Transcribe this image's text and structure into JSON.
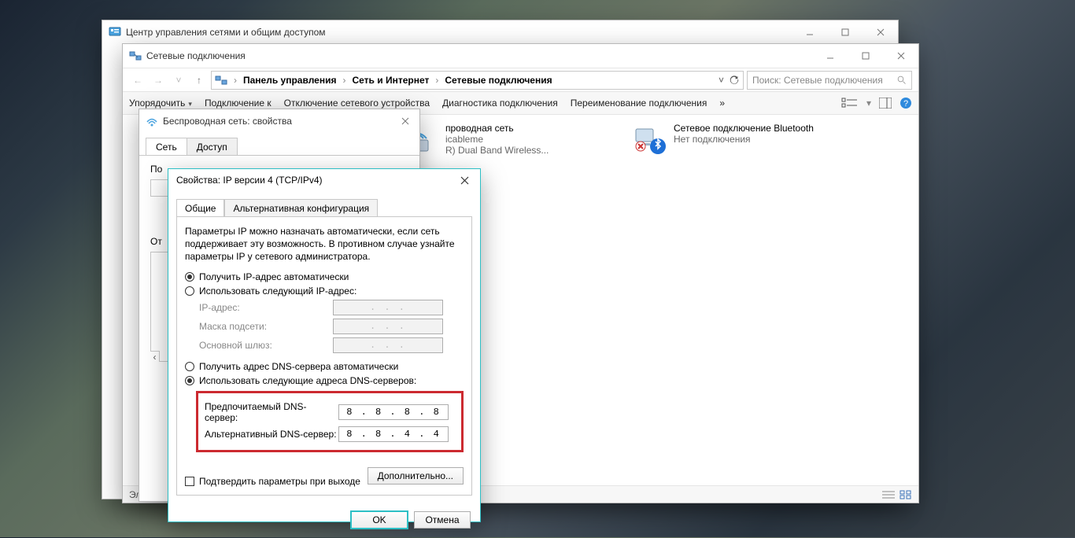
{
  "bgWin": {
    "title": "Центр управления сетями и общим доступом"
  },
  "explorer": {
    "title": "Сетевые подключения",
    "breadcrumb": [
      "Панель управления",
      "Сеть и Интернет",
      "Сетевые подключения"
    ],
    "search_placeholder": "Поиск: Сетевые подключения",
    "toolbar": {
      "organize": "Упорядочить",
      "connect": "Подключение к",
      "disable": "Отключение сетевого устройства",
      "diagnose": "Диагностика подключения",
      "rename": "Переименование подключения",
      "more": "»"
    },
    "connections": [
      {
        "name": "Беспроводная сеть",
        "line2": "icableme",
        "line3": "R) Dual Band Wireless..."
      },
      {
        "name": "Сетевое подключение Bluetooth",
        "line2": "Нет подключения",
        "line3": ""
      }
    ],
    "status": "Элемент"
  },
  "wirelessProps": {
    "title": "Беспроводная сеть: свойства",
    "tabs": {
      "network": "Сеть",
      "access": "Доступ"
    },
    "subLabel": "По",
    "subLabel2": "От"
  },
  "ipv4": {
    "title": "Свойства: IP версии 4 (TCP/IPv4)",
    "tabs": {
      "general": "Общие",
      "alt": "Альтернативная конфигурация"
    },
    "intro": "Параметры IP можно назначать автоматически, если сеть поддерживает эту возможность. В противном случае узнайте параметры IP у сетевого администратора.",
    "radio_ip_auto": "Получить IP-адрес автоматически",
    "radio_ip_manual": "Использовать следующий IP-адрес:",
    "fields": {
      "ip": "IP-адрес:",
      "mask": "Маска подсети:",
      "gateway": "Основной шлюз:"
    },
    "radio_dns_auto": "Получить адрес DNS-сервера автоматически",
    "radio_dns_manual": "Использовать следующие адреса DNS-серверов:",
    "dns_pref_label": "Предпочитаемый DNS-сервер:",
    "dns_alt_label": "Альтернативный DNS-сервер:",
    "dns_pref_value": "8 . 8 . 8 . 8",
    "dns_alt_value": "8 . 8 . 4 . 4",
    "validate_on_exit": "Подтвердить параметры при выходе",
    "advanced": "Дополнительно...",
    "ok": "OK",
    "cancel": "Отмена",
    "placeholder_ip": ".       .       ."
  }
}
